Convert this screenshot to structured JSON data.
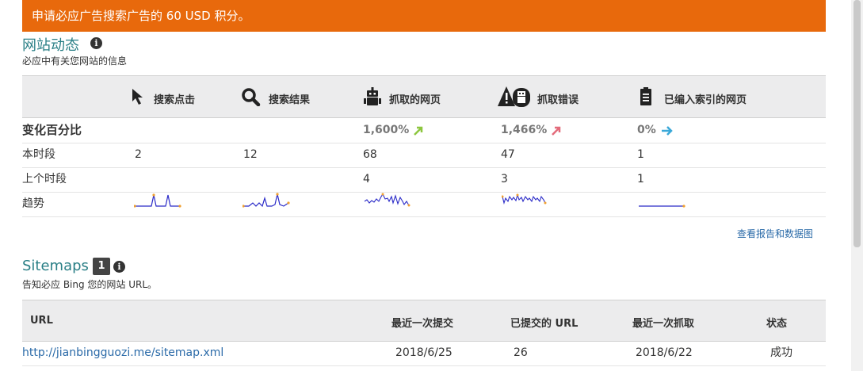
{
  "banner": {
    "text": "申请必应广告搜索广告的 60 USD 积分。"
  },
  "site_activity": {
    "title": "网站动态",
    "subtitle": "必应中有关您网站的信息",
    "columns": [
      {
        "label": "搜索点击",
        "icon": "cursor-icon"
      },
      {
        "label": "搜索结果",
        "icon": "search-icon"
      },
      {
        "label": "抓取的网页",
        "icon": "robot-icon"
      },
      {
        "label": "抓取错误",
        "icon": "robot-warning-icon"
      },
      {
        "label": "已编入索引的网页",
        "icon": "document-icon"
      }
    ],
    "change_row": {
      "label": "变化百分比",
      "crawled": "1,600%",
      "errors": "1,466%",
      "indexed": "0%"
    },
    "current_row": {
      "label": "本时段",
      "values": [
        "2",
        "12",
        "68",
        "47",
        "1"
      ]
    },
    "previous_row": {
      "label": "上个时段",
      "values": [
        "",
        "",
        "4",
        "3",
        "1"
      ]
    },
    "trend_row": {
      "label": "趋势"
    },
    "colors": {
      "up_green": "#8dc63f",
      "up_red": "#e36b7b",
      "flat_blue": "#3aa8d8"
    },
    "report_link": "查看报告和数据图"
  },
  "sitemaps": {
    "title": "Sitemaps",
    "count": "1",
    "subtitle": "告知必应 Bing 您的网站 URL。",
    "headers": {
      "url": "URL",
      "last_submitted": "最近一次提交",
      "submitted_urls": "已提交的 URL",
      "last_crawled": "最近一次抓取",
      "status": "状态"
    },
    "rows": [
      {
        "url": "http://jianbingguozi.me/sitemap.xml",
        "last_submitted": "2018/6/25",
        "submitted_urls": "26",
        "last_crawled": "2018/6/22",
        "status": "成功"
      }
    ]
  }
}
